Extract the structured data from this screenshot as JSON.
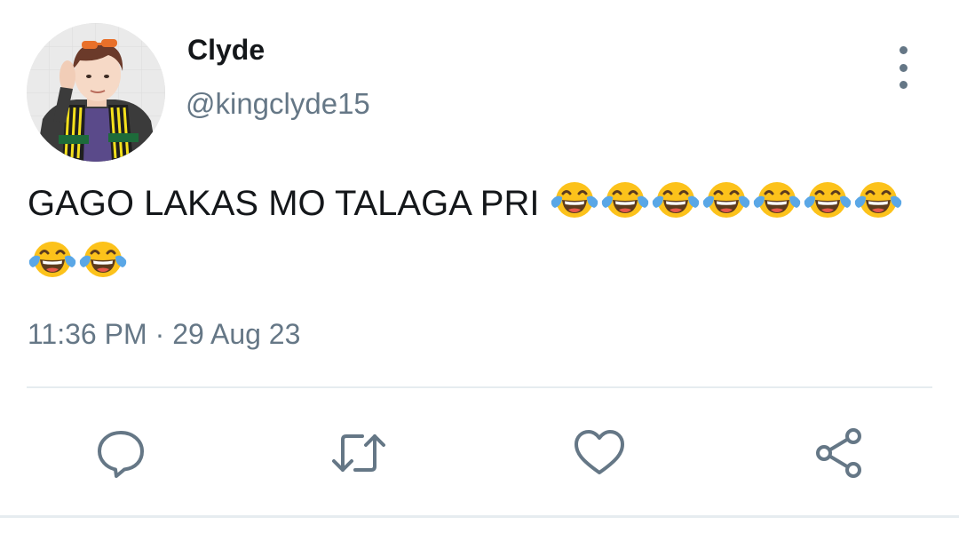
{
  "user": {
    "name": "Clyde",
    "handle": "@kingclyde15",
    "avatar_icon": "profile-photo"
  },
  "tweet": {
    "text": "GAGO LAKAS MO TALAGA PRI",
    "emoji": "face-with-tears-of-joy",
    "emoji_count": 9,
    "time": "11:36 PM",
    "separator": "·",
    "date": "29 Aug 23"
  },
  "actions": [
    {
      "name": "reply",
      "icon": "reply-icon"
    },
    {
      "name": "retweet",
      "icon": "retweet-icon"
    },
    {
      "name": "like",
      "icon": "heart-icon"
    },
    {
      "name": "share",
      "icon": "share-icon"
    }
  ],
  "colors": {
    "text": "#14171a",
    "secondary": "#657786",
    "divider": "#e6ecf0",
    "emoji_face": "#fcc21b"
  }
}
